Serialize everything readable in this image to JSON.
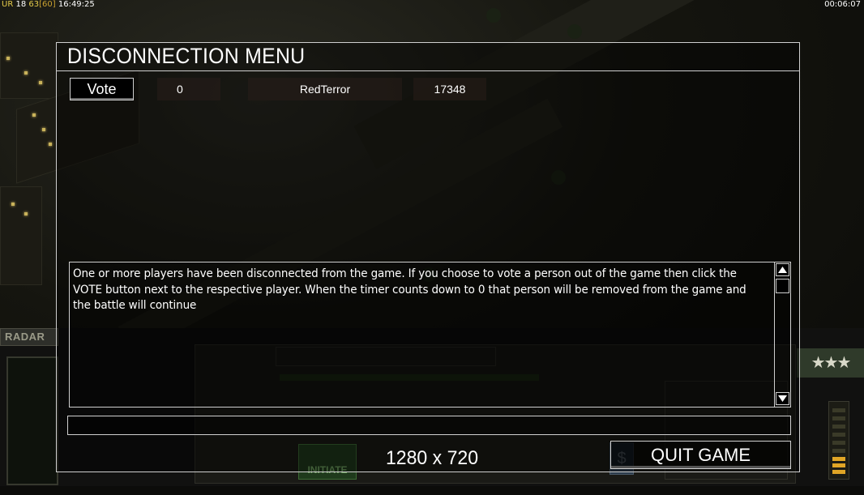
{
  "overlay": {
    "ur_label": "UR",
    "ur_value": "18",
    "fps": "63",
    "fps_max": "[60]",
    "clock": "16:49:25",
    "game_timer": "00:06:07"
  },
  "hud": {
    "radar_label": "RADAR",
    "initiate_label": "INITIATE",
    "dollar_symbol": "$",
    "stars": "★★★"
  },
  "dialog": {
    "title": "DISCONNECTION MENU",
    "players": [
      {
        "vote_label": "Vote",
        "votes": "0",
        "name": "RedTerror",
        "ping": "17348"
      }
    ],
    "message": "One or more players have been disconnected from the game. If you choose to vote a person out of the game then click the VOTE button next to the respective player. When the timer counts down to 0 that person will be removed from the game and the battle will continue",
    "chat_value": "",
    "resolution": "1280 x 720",
    "quit_label": "QUIT GAME"
  }
}
